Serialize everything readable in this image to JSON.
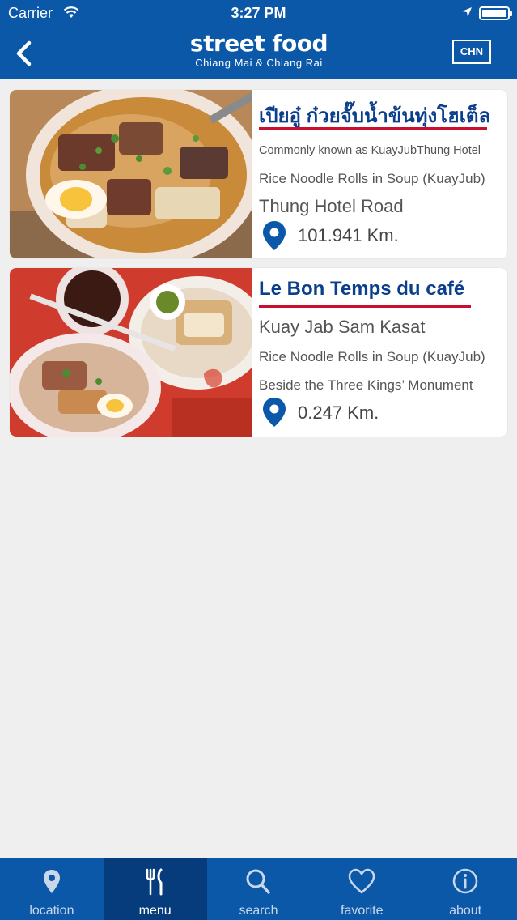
{
  "status_bar": {
    "carrier": "Carrier",
    "time": "3:27 PM"
  },
  "header": {
    "logo_main": "street food",
    "logo_sub": "Chiang Mai & Chiang Rai",
    "lang_button": "CHN"
  },
  "cards": [
    {
      "title": "เปียอู๋ ก๋วยจั๊บน้ำข้นทุ่งโฮเต็ล",
      "subtitle": "Commonly known as KuayJubThung Hotel",
      "dish": "Rice Noodle Rolls in Soup (KuayJub)",
      "location": "Thung Hotel Road",
      "distance": "101.941 Km."
    },
    {
      "title": "Le Bon Temps du café",
      "subtitle": "Kuay Jab Sam Kasat",
      "dish": "Rice Noodle Rolls in Soup (KuayJub)",
      "location": "Beside the Three Kings’ Monument",
      "distance": "0.247 Km."
    }
  ],
  "tabs": [
    {
      "label": "location",
      "icon": "location-pin-icon"
    },
    {
      "label": "menu",
      "icon": "fork-knife-icon",
      "active": true
    },
    {
      "label": "search",
      "icon": "search-icon"
    },
    {
      "label": "favorite",
      "icon": "heart-icon"
    },
    {
      "label": "about",
      "icon": "info-icon"
    }
  ],
  "colors": {
    "header": "#0b57a8",
    "active_tab": "#063c7c",
    "title_blue": "#0b3e8c",
    "accent_red": "#c8102e"
  }
}
